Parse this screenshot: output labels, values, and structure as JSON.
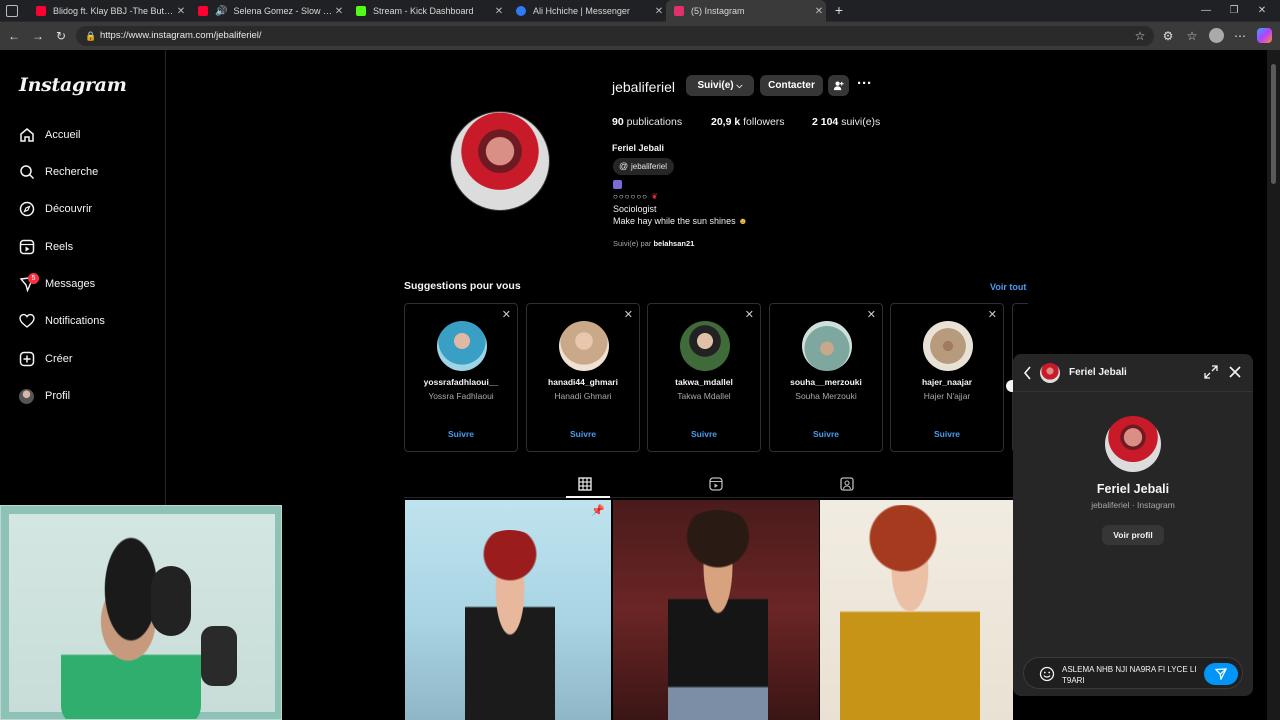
{
  "browser": {
    "tabs": [
      {
        "title": "Blidog ft. Klay BBJ -The Butchers",
        "favicon_color": "#ff0033",
        "active": false
      },
      {
        "title": "Selena Gomez - Slow Down",
        "favicon_color": "#ff0033",
        "active": false
      },
      {
        "title": "Stream - Kick Dashboard",
        "favicon_color": "#53fc18",
        "active": false
      },
      {
        "title": "Ali Hchiche | Messenger",
        "favicon_color": "#2f7bf6",
        "active": false
      },
      {
        "title": "(5) Instagram",
        "favicon_color": "#e1306c",
        "active": true
      }
    ],
    "new_tab": "+",
    "url": "https://www.instagram.com/jebaliferiel/"
  },
  "sidebar": {
    "logo": "Instagram",
    "items": [
      {
        "label": "Accueil",
        "icon": "home-icon"
      },
      {
        "label": "Recherche",
        "icon": "search-icon"
      },
      {
        "label": "Découvrir",
        "icon": "compass-icon"
      },
      {
        "label": "Reels",
        "icon": "reels-icon"
      },
      {
        "label": "Messages",
        "icon": "messenger-icon",
        "badge": "5"
      },
      {
        "label": "Notifications",
        "icon": "heart-icon"
      },
      {
        "label": "Créer",
        "icon": "plus-square-icon"
      },
      {
        "label": "Profil",
        "icon": "avatar-icon"
      }
    ]
  },
  "profile": {
    "username": "jebaliferiel",
    "followed_label": "Suivi(e)",
    "contact_label": "Contacter",
    "stats": {
      "posts_count": "90",
      "posts_label": "publications",
      "followers_count": "20,9 k",
      "followers_label": "followers",
      "following_count": "2 104",
      "following_label": "suivi(e)s"
    },
    "full_name": "Feriel Jebali",
    "threads_handle": "jebaliferiel",
    "bio_line1": "Sociologist",
    "bio_line2": "Make hay while the sun shines",
    "followed_by_prefix": "Suivi(e) par",
    "followed_by_user": "belahsan21"
  },
  "suggestions": {
    "title": "Suggestions pour vous",
    "see_all": "Voir tout",
    "follow_label": "Suivre",
    "items": [
      {
        "username": "yossrafadhlaoui__",
        "name": "Yossra Fadhlaoui",
        "color": "#3a9fc4"
      },
      {
        "username": "hanadi44_ghmari",
        "name": "Hanadi Ghmari",
        "color": "#c9a98a"
      },
      {
        "username": "takwa_mdallel",
        "name": "Takwa Mdallel",
        "color": "#3f6b3a"
      },
      {
        "username": "souha__merzouki",
        "name": "Souha Merzouki",
        "color": "#7ea7a0"
      },
      {
        "username": "hajer_naajar",
        "name": "Hajer N'ajjar",
        "color": "#b89a7c"
      }
    ]
  },
  "chat": {
    "header_name": "Feriel Jebali",
    "full_name": "Feriel Jebali",
    "subtitle": "jebaliferiel · Instagram",
    "view_profile": "Voir profil",
    "draft_message": "ASLEMA NHB NJI NA9RA FI LYCE LI T9ARI"
  },
  "colors": {
    "link_blue": "#4a9cf0",
    "send_blue": "#0095f6",
    "badge_red": "#ff3040"
  }
}
